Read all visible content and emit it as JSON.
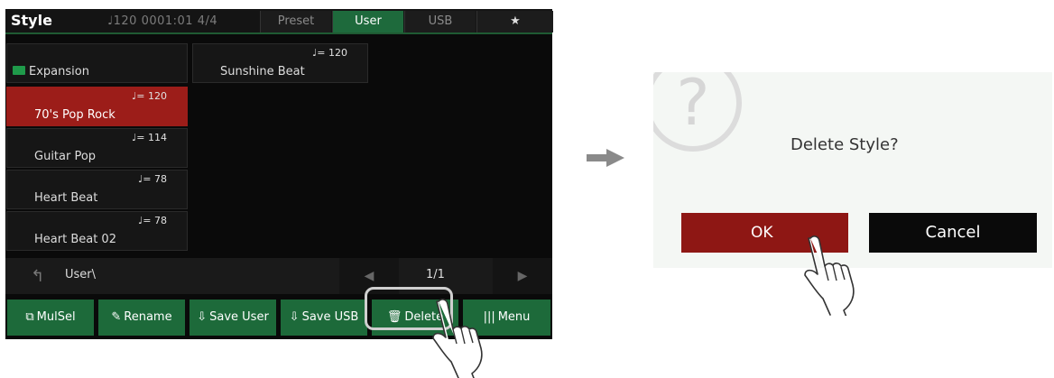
{
  "style_screen": {
    "title": "Style",
    "status": "♩120  0001:01  4/4",
    "tabs": [
      {
        "label": "Preset"
      },
      {
        "label": "User"
      },
      {
        "label": "USB"
      },
      {
        "label": "★"
      }
    ],
    "folder": {
      "label": "Expansion"
    },
    "styles": [
      {
        "tempo": "♩= 120",
        "name": "Sunshine Beat"
      },
      {
        "tempo": "♩= 120",
        "name": "70's Pop Rock"
      },
      {
        "tempo": "♩= 114",
        "name": "Guitar Pop"
      },
      {
        "tempo": "♩= 78",
        "name": "Heart Beat"
      },
      {
        "tempo": "♩= 78",
        "name": "Heart Beat 02"
      }
    ],
    "nav": {
      "path": "User\\",
      "page": "1/1"
    },
    "buttons": {
      "mulsel": "MulSel",
      "rename": "Rename",
      "save_user": "Save User",
      "save_usb": "Save USB",
      "delete": "Delete",
      "menu": "Menu"
    }
  },
  "dialog": {
    "question": "Delete Style?",
    "ok": "OK",
    "cancel": "Cancel"
  },
  "colors": {
    "accent_green": "#1d6a3a",
    "selected_red": "#9c1d19",
    "ok_red": "#8e1714"
  }
}
